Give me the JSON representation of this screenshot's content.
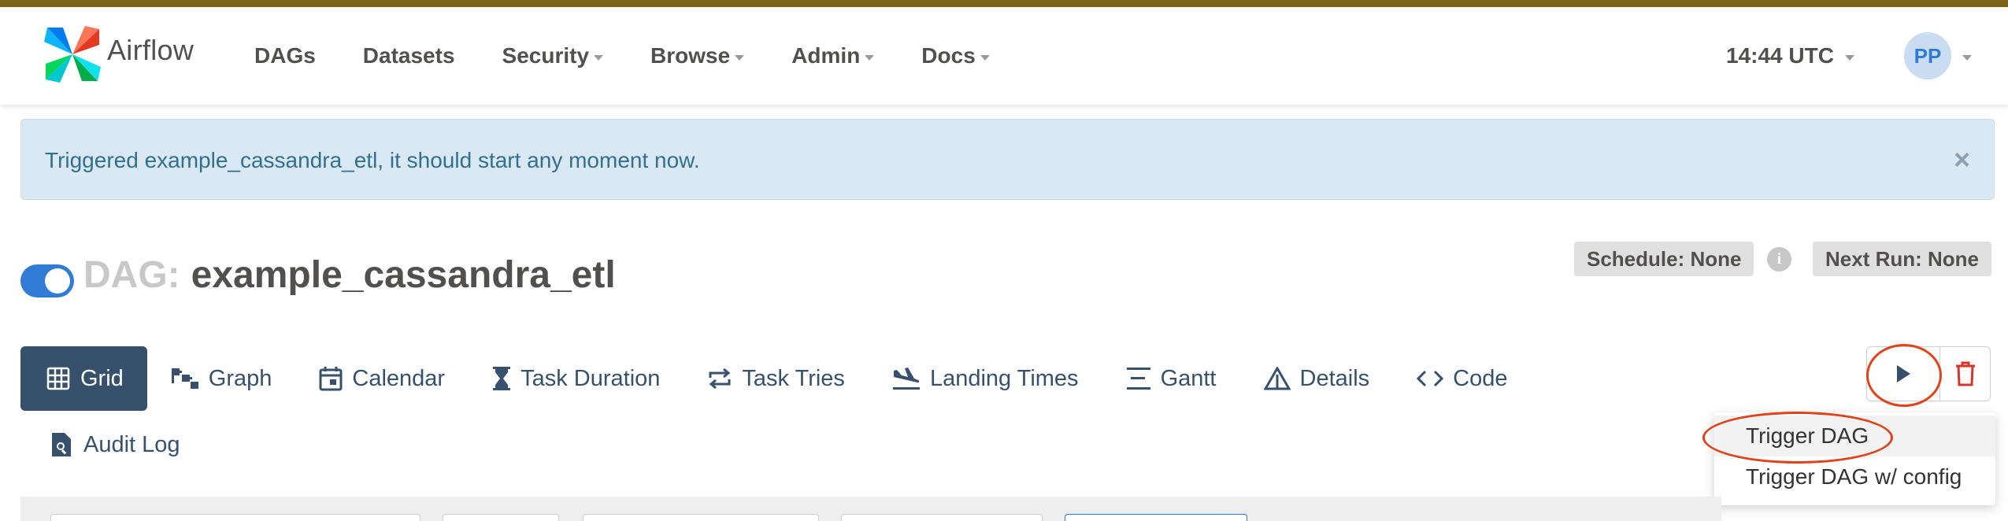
{
  "brand": {
    "name": "Airflow",
    "icon": "airflow-pinwheel-icon"
  },
  "nav": {
    "items": [
      {
        "label": "DAGs",
        "dropdown": false
      },
      {
        "label": "Datasets",
        "dropdown": false
      },
      {
        "label": "Security",
        "dropdown": true
      },
      {
        "label": "Browse",
        "dropdown": true
      },
      {
        "label": "Admin",
        "dropdown": true
      },
      {
        "label": "Docs",
        "dropdown": true
      }
    ],
    "time": "14:44 UTC",
    "avatar_initials": "PP"
  },
  "alert": {
    "message": "Triggered example_cassandra_etl, it should start any moment now.",
    "close": "×"
  },
  "dag": {
    "label": "DAG:",
    "name": "example_cassandra_etl",
    "paused": false,
    "schedule": "Schedule: None",
    "next_run": "Next Run: None",
    "info": "i"
  },
  "tabs": [
    {
      "label": "Grid",
      "icon": "grid-icon",
      "active": true
    },
    {
      "label": "Graph",
      "icon": "graph-icon",
      "active": false
    },
    {
      "label": "Calendar",
      "icon": "calendar-icon",
      "active": false
    },
    {
      "label": "Task Duration",
      "icon": "hourglass-icon",
      "active": false
    },
    {
      "label": "Task Tries",
      "icon": "repeat-icon",
      "active": false
    },
    {
      "label": "Landing Times",
      "icon": "plane-landing-icon",
      "active": false
    },
    {
      "label": "Gantt",
      "icon": "gantt-icon",
      "active": false
    },
    {
      "label": "Details",
      "icon": "warning-triangle-icon",
      "active": false
    },
    {
      "label": "Code",
      "icon": "code-icon",
      "active": false
    },
    {
      "label": "Audit Log",
      "icon": "file-search-icon",
      "active": false
    }
  ],
  "actions": {
    "trigger_icon": "play-icon",
    "delete_icon": "trash-icon"
  },
  "trigger_menu": {
    "items": [
      "Trigger DAG",
      "Trigger DAG w/ config"
    ]
  },
  "colors": {
    "top_stripe": "#7c6418",
    "accent": "#37516d",
    "toggle": "#2f7bd6",
    "highlight": "#e0431c",
    "delete": "#d9352a"
  }
}
